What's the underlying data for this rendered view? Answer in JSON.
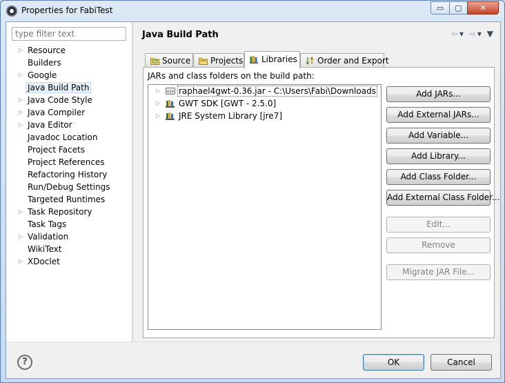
{
  "window": {
    "title": "Properties for FabiTest",
    "min_glyph": "▭",
    "max_glyph": "▢",
    "close_glyph": "✕"
  },
  "sidebar": {
    "filter_placeholder": "type filter text",
    "items": [
      {
        "label": "Resource",
        "expandable": true
      },
      {
        "label": "Builders",
        "expandable": false
      },
      {
        "label": "Google",
        "expandable": true
      },
      {
        "label": "Java Build Path",
        "expandable": false,
        "selected": true
      },
      {
        "label": "Java Code Style",
        "expandable": true
      },
      {
        "label": "Java Compiler",
        "expandable": true
      },
      {
        "label": "Java Editor",
        "expandable": true
      },
      {
        "label": "Javadoc Location",
        "expandable": false
      },
      {
        "label": "Project Facets",
        "expandable": false
      },
      {
        "label": "Project References",
        "expandable": false
      },
      {
        "label": "Refactoring History",
        "expandable": false
      },
      {
        "label": "Run/Debug Settings",
        "expandable": false
      },
      {
        "label": "Targeted Runtimes",
        "expandable": false
      },
      {
        "label": "Task Repository",
        "expandable": true
      },
      {
        "label": "Task Tags",
        "expandable": false
      },
      {
        "label": "Validation",
        "expandable": true
      },
      {
        "label": "WikiText",
        "expandable": false
      },
      {
        "label": "XDoclet",
        "expandable": true
      }
    ]
  },
  "page": {
    "title": "Java Build Path",
    "nav": {
      "back": "⇦",
      "forward": "⇨",
      "dropdown": "▾",
      "menu": "▼"
    }
  },
  "tabs": [
    {
      "label": "Source",
      "icon": "source-folder-icon"
    },
    {
      "label": "Projects",
      "icon": "projects-folder-icon"
    },
    {
      "label": "Libraries",
      "icon": "libraries-icon",
      "active": true
    },
    {
      "label": "Order and Export",
      "icon": "order-export-icon"
    }
  ],
  "libraries": {
    "caption": "JARs and class folders on the build path:",
    "entries": [
      {
        "label": "raphael4gwt-0.36.jar - C:\\Users\\Fabi\\Downloads",
        "icon": "jar-icon"
      },
      {
        "label": "GWT SDK [GWT - 2.5.0]",
        "icon": "library-icon"
      },
      {
        "label": "JRE System Library [jre7]",
        "icon": "library-icon"
      }
    ],
    "buttons": [
      {
        "label": "Add JARs...",
        "enabled": true
      },
      {
        "label": "Add External JARs...",
        "enabled": true
      },
      {
        "label": "Add Variable...",
        "enabled": true
      },
      {
        "label": "Add Library...",
        "enabled": true
      },
      {
        "label": "Add Class Folder...",
        "enabled": true
      },
      {
        "label": "Add External Class Folder...",
        "enabled": true
      },
      {
        "label": "Edit...",
        "enabled": false
      },
      {
        "label": "Remove",
        "enabled": false
      },
      {
        "label": "Migrate JAR File...",
        "enabled": false
      }
    ]
  },
  "footer": {
    "help": "?",
    "ok": "OK",
    "cancel": "Cancel"
  },
  "colors": {
    "selection": "#e5f0fb",
    "default_button_border": "#3c7fb1",
    "jar_icon": "#6b6b6b",
    "library_icon_books": "#3a7d2a"
  }
}
